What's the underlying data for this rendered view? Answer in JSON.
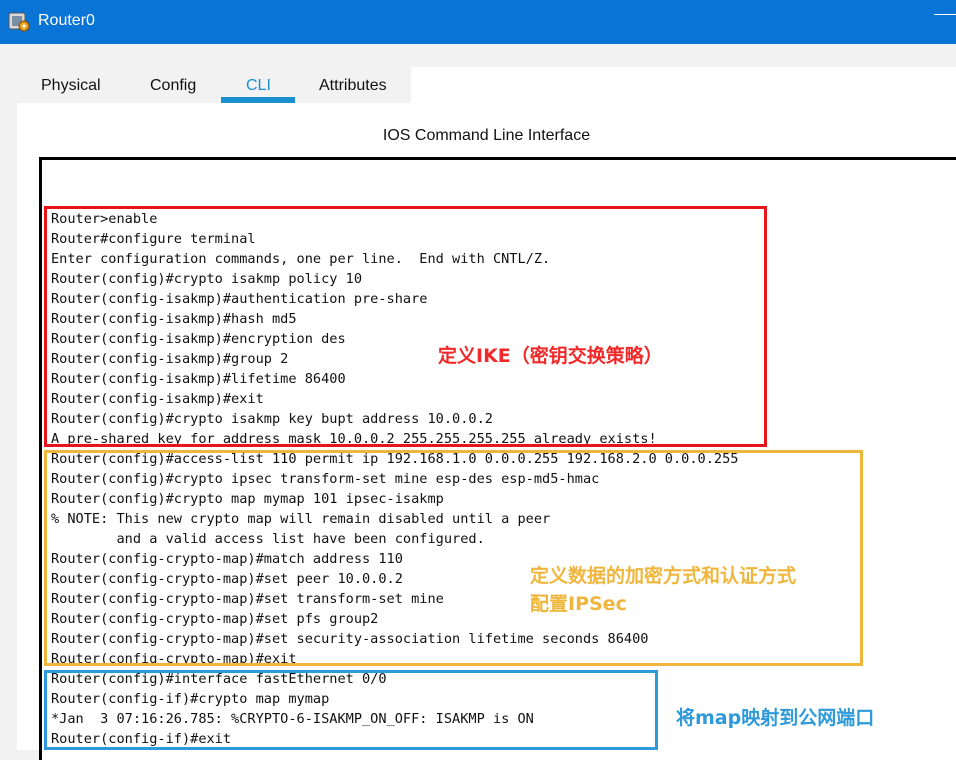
{
  "window": {
    "title": "Router0"
  },
  "tabs": [
    {
      "label": "Physical"
    },
    {
      "label": "Config"
    },
    {
      "label": "CLI"
    },
    {
      "label": "Attributes"
    }
  ],
  "active_tab": "CLI",
  "cli": {
    "header": "IOS Command Line Interface",
    "lines": [
      "Router>enable",
      "Router#configure terminal",
      "Enter configuration commands, one per line.  End with CNTL/Z.",
      "Router(config)#crypto isakmp policy 10",
      "Router(config-isakmp)#authentication pre-share",
      "Router(config-isakmp)#hash md5",
      "Router(config-isakmp)#encryption des",
      "Router(config-isakmp)#group 2",
      "Router(config-isakmp)#lifetime 86400",
      "Router(config-isakmp)#exit",
      "Router(config)#crypto isakmp key bupt address 10.0.0.2",
      "A pre-shared key for address mask 10.0.0.2 255.255.255.255 already exists!",
      "Router(config)#access-list 110 permit ip 192.168.1.0 0.0.0.255 192.168.2.0 0.0.0.255",
      "Router(config)#crypto ipsec transform-set mine esp-des esp-md5-hmac",
      "Router(config)#crypto map mymap 101 ipsec-isakmp",
      "% NOTE: This new crypto map will remain disabled until a peer",
      "        and a valid access list have been configured.",
      "Router(config-crypto-map)#match address 110",
      "Router(config-crypto-map)#set peer 10.0.0.2",
      "Router(config-crypto-map)#set transform-set mine",
      "Router(config-crypto-map)#set pfs group2",
      "Router(config-crypto-map)#set security-association lifetime seconds 86400",
      "Router(config-crypto-map)#exit",
      "Router(config)#interface fastEthernet 0/0",
      "Router(config-if)#crypto map mymap",
      "*Jan  3 07:16:26.785: %CRYPTO-6-ISAKMP_ON_OFF: ISAKMP is ON",
      "Router(config-if)#exit"
    ]
  },
  "annotations": {
    "ike": "定义IKE（密钥交换策略）",
    "ipsec_line1": "定义数据的加密方式和认证方式",
    "ipsec_line2": "配置IPSec",
    "map": "将map映射到公网端口"
  },
  "colors": {
    "titlebar": "#0a73d6",
    "active_tab": "#1a90d0",
    "ike_box": "#e8141b",
    "ipsec_box": "#f0b63c",
    "map_box": "#2e9ad9"
  },
  "icons": {
    "app": "router-icon"
  }
}
